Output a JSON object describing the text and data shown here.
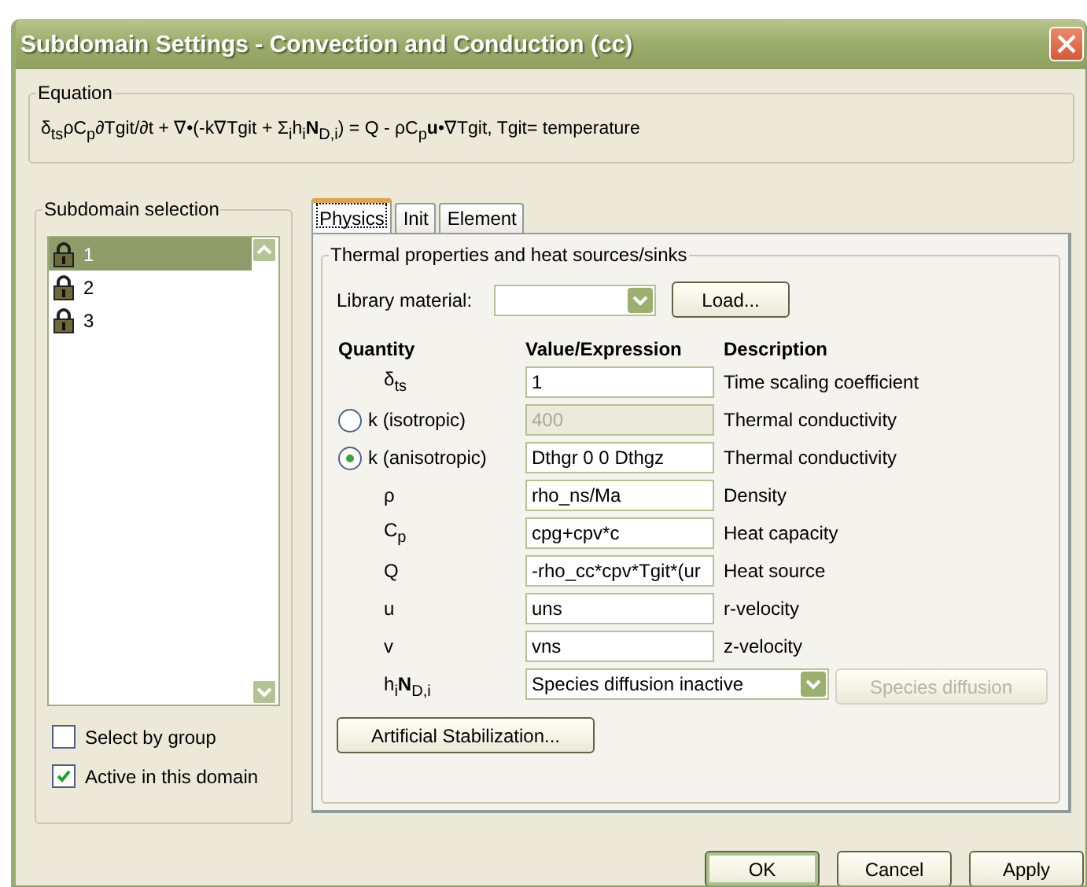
{
  "window": {
    "title": "Subdomain Settings - Convection and Conduction (cc)"
  },
  "equation": {
    "label": "Equation",
    "text": "δ$_{ts}$ρC$_{p}$∂Tgit/∂t + ∇•(-k∇Tgit + Σ$_{i}$h$_{i}$**N**$_{D,i}$) = Q - ρC$_{p}$**u**•∇Tgit, Tgit= temperature"
  },
  "subdomain_selection": {
    "label": "Subdomain selection",
    "items": [
      {
        "label": "1",
        "selected": true
      },
      {
        "label": "2",
        "selected": false
      },
      {
        "label": "3",
        "selected": false
      }
    ],
    "checkboxes": [
      {
        "label": "Select by group",
        "checked": false
      },
      {
        "label": "Active in this domain",
        "checked": true
      }
    ]
  },
  "tabs": [
    {
      "label": "Physics",
      "selected": true
    },
    {
      "label": "Init",
      "selected": false
    },
    {
      "label": "Element",
      "selected": false
    }
  ],
  "physics": {
    "group_label": "Thermal properties and heat sources/sinks",
    "library_label": "Library material:",
    "load_button": "Load...",
    "columns": [
      "Quantity",
      "Value/Expression",
      "Description"
    ],
    "rows": [
      {
        "kind": "plain",
        "quantity": "δ$_{ts}$",
        "value": "1",
        "disabled": false,
        "description": "Time scaling coefficient"
      },
      {
        "kind": "radio",
        "quantity": "k (isotropic)",
        "selected": false,
        "value": "400",
        "disabled": true,
        "description": "Thermal conductivity"
      },
      {
        "kind": "radio",
        "quantity": "k (anisotropic)",
        "selected": true,
        "value": "Dthgr 0 0 Dthgz",
        "disabled": false,
        "description": "Thermal conductivity"
      },
      {
        "kind": "plain",
        "quantity": "ρ",
        "value": "rho_ns/Ma",
        "disabled": false,
        "description": "Density"
      },
      {
        "kind": "plain",
        "quantity": "C$_{p}$",
        "value": "cpg+cpv*c",
        "disabled": false,
        "description": "Heat capacity"
      },
      {
        "kind": "plain",
        "quantity": "Q",
        "value": "-rho_cc*cpv*Tgit*(ur",
        "disabled": false,
        "description": "Heat source"
      },
      {
        "kind": "plain",
        "quantity": "u",
        "value": "uns",
        "disabled": false,
        "description": "r-velocity"
      },
      {
        "kind": "plain",
        "quantity": "v",
        "value": "vns",
        "disabled": false,
        "description": "z-velocity"
      },
      {
        "kind": "select",
        "quantity": "h$_{i}$**N**$_{D,i}$",
        "value": "Species diffusion inactive",
        "button": {
          "label": "Species diffusion",
          "disabled": true
        }
      }
    ],
    "stabilization_button": "Artificial Stabilization..."
  },
  "buttons": [
    {
      "label": "OK",
      "default": true
    },
    {
      "label": "Cancel",
      "default": false
    },
    {
      "label": "Apply",
      "default": false
    }
  ]
}
